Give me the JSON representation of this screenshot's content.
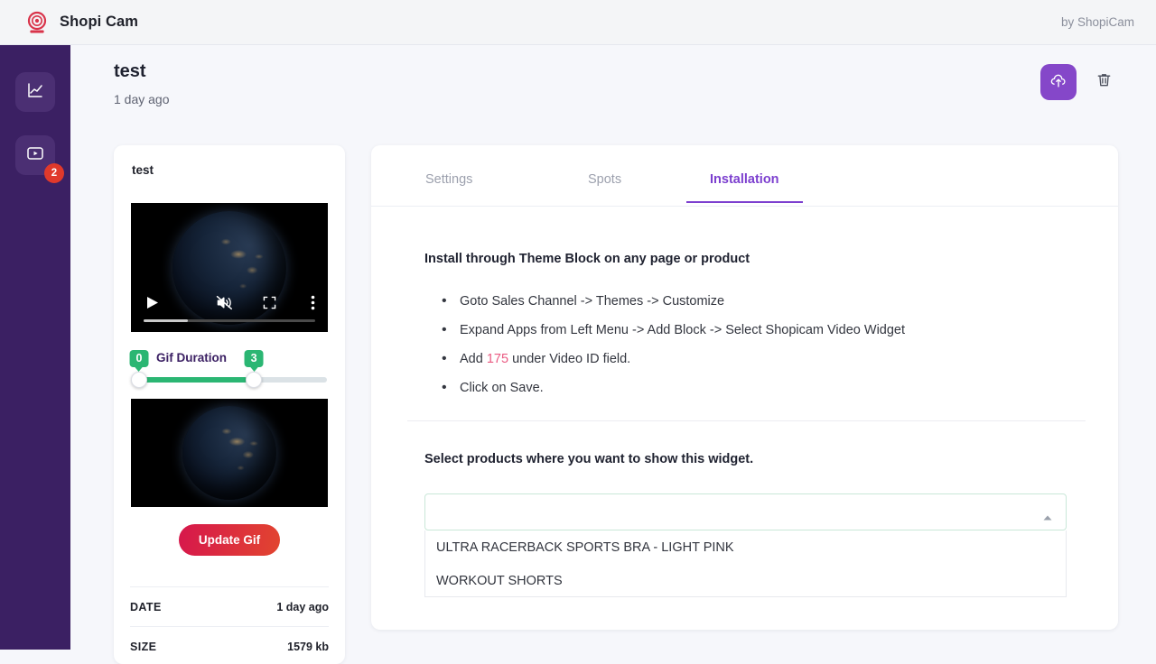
{
  "topbar": {
    "logo_icon": "webcam-logo-icon",
    "brand_name": "Shopi Cam",
    "byline": "by ShopiCam"
  },
  "sidebar": {
    "items": [
      {
        "icon": "analytics-chart-icon",
        "name": "sidebar-item-analytics",
        "badge": null
      },
      {
        "icon": "video-player-icon",
        "name": "sidebar-item-videos",
        "badge": "2"
      }
    ]
  },
  "page_header": {
    "title": "test",
    "subtitle": "1 day ago",
    "upload_icon": "cloud-upload-icon",
    "delete_icon": "trash-icon"
  },
  "video_card": {
    "title": "test",
    "video_controls": {
      "play_icon": "play-icon",
      "mute_icon": "volume-muted-icon",
      "fullscreen_icon": "fullscreen-icon",
      "menu_icon": "three-dots-menu-icon"
    },
    "slider": {
      "label": "Gif Duration",
      "min_value": "0",
      "max_value": "3"
    },
    "update_button": "Update Gif",
    "meta": [
      {
        "key": "DATE",
        "value": "1 day ago"
      },
      {
        "key": "SIZE",
        "value": "1579 kb"
      }
    ]
  },
  "main": {
    "tabs": [
      {
        "label": "Settings",
        "active": false
      },
      {
        "label": "Spots",
        "active": false
      },
      {
        "label": "Installation",
        "active": true
      }
    ],
    "install": {
      "heading": "Install through Theme Block on any page or product",
      "steps": [
        {
          "before": "Goto Sales Channel -> Themes -> Customize",
          "highlight": "",
          "after": ""
        },
        {
          "before": "Expand Apps from Left Menu -> Add Block -> Select Shopicam Video Widget",
          "highlight": "",
          "after": ""
        },
        {
          "before": "Add ",
          "highlight": "175",
          "after": " under Video ID field."
        },
        {
          "before": "Click on Save.",
          "highlight": "",
          "after": ""
        }
      ]
    },
    "product_select": {
      "label": "Select products where you want to show this widget.",
      "value": "",
      "placeholder": "",
      "caret_icon": "chevron-up-icon",
      "options": [
        "ULTRA RACERBACK SPORTS BRA - LIGHT PINK",
        "WORKOUT SHORTS"
      ]
    }
  },
  "colors": {
    "sidebar": "#3b2063",
    "accent_purple": "#7c3fcf",
    "upload_purple": "#8547c9",
    "badge_red": "#e0392b",
    "slider_green": "#2bb673",
    "highlight_pink": "#ea5a82",
    "select_border": "#c9e7d8"
  }
}
